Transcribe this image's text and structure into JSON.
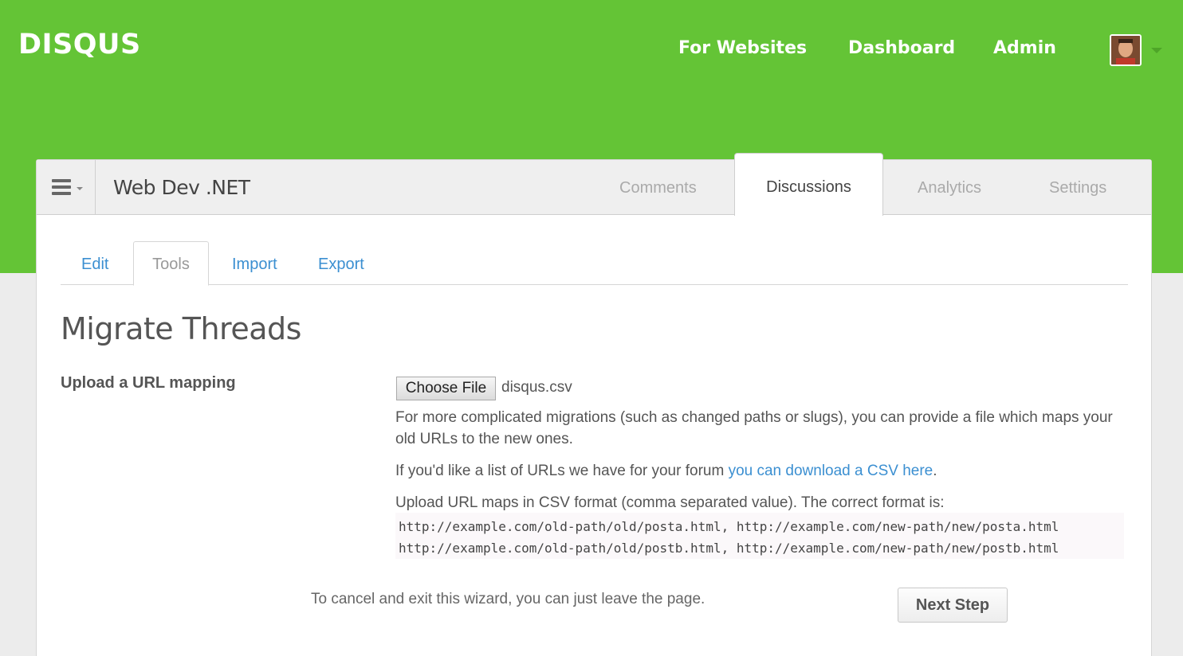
{
  "header": {
    "logo": "DISQUS",
    "nav": [
      "For Websites",
      "Dashboard",
      "Admin"
    ],
    "brand_color": "#64c436"
  },
  "site": {
    "title": "Web Dev .NET",
    "tabs": [
      "Comments",
      "Discussions",
      "Analytics",
      "Settings"
    ],
    "active_tab": "Discussions"
  },
  "subtabs": {
    "items": [
      "Edit",
      "Tools",
      "Import",
      "Export"
    ],
    "active": "Tools"
  },
  "main": {
    "title": "Migrate Threads",
    "field_label": "Upload a URL mapping",
    "file_button": "Choose File",
    "file_name": "disqus.csv",
    "help1": "For more complicated migrations (such as changed paths or slugs), you can provide a file which maps your old URLs to the new ones.",
    "help2_prefix": "If you'd like a list of URLs we have for your forum ",
    "help2_link": "you can download a CSV here",
    "help2_suffix": ".",
    "help3": "Upload URL maps in CSV format (comma separated value). The correct format is:",
    "code_lines": [
      "http://example.com/old-path/old/posta.html, http://example.com/new-path/new/posta.html",
      "http://example.com/old-path/old/postb.html, http://example.com/new-path/new/postb.html"
    ],
    "cancel_text": "To cancel and exit this wizard, you can just leave the page.",
    "next_button": "Next Step"
  }
}
